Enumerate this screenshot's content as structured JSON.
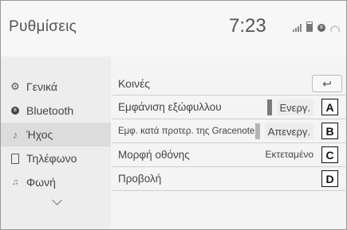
{
  "header": {
    "title": "Ρυθμίσεις",
    "clock": "7:23",
    "status_icons": [
      "signal-icon",
      "battery-icon",
      "bluetooth-icon",
      "wifi-icon"
    ]
  },
  "sidebar": {
    "items": [
      {
        "label": "Γενικά",
        "icon": "gear-icon"
      },
      {
        "label": "Bluetooth",
        "icon": "bluetooth-icon"
      },
      {
        "label": "Ήχος",
        "icon": "music-note-icon",
        "active": true
      },
      {
        "label": "Τηλέφωνο",
        "icon": "phone-icon"
      },
      {
        "label": "Φωνή",
        "icon": "voice-icon"
      }
    ],
    "more_icon": "chevron-down-icon"
  },
  "main": {
    "section_title": "Κοινές",
    "back_icon": "back-arrow-icon",
    "rows": [
      {
        "label": "Εμφάνιση εξώφυλλου",
        "value": "Ενεργ.",
        "callout": "A"
      },
      {
        "label": "Εμφ. κατά προτερ. της Gracenote",
        "value": "Απενεργ.",
        "callout": "B"
      },
      {
        "label": "Μορφή οθόνης",
        "value": "Εκτεταμένο",
        "callout": "C"
      },
      {
        "label": "Προβολή",
        "value": "",
        "callout": "D"
      }
    ]
  },
  "colors": {
    "background": "#f4f4f4",
    "sidebar": "#ededed",
    "active_item": "#dcdcdc",
    "toggle_on": "#7a7a7a",
    "toggle_off": "#b5b5b5"
  }
}
